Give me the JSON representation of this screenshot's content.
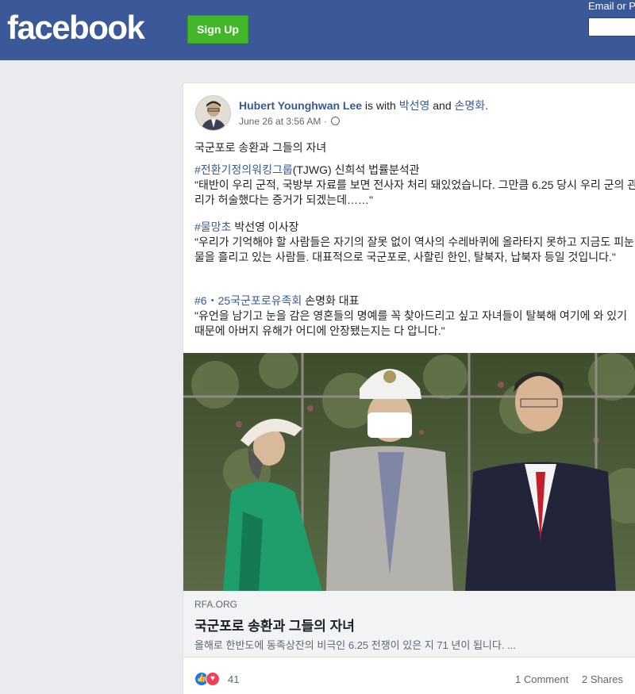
{
  "header": {
    "logo": "facebook",
    "signup_label": "Sign Up",
    "email_label": "Email or P"
  },
  "post": {
    "author": "Hubert Younghwan Lee",
    "with_text": " is with ",
    "tagged1": "박선영",
    "and_text": " and ",
    "tagged2": "손명화",
    "period": ".",
    "date": "June 26 at 3:56 AM · ",
    "title": "국군포로 송환과 그들의 자녀",
    "p1_tag": "#전환기정의워킹그룹",
    "p1_rest": "(TJWG) 신희석 법률분석관",
    "p1_quote": "\"태반이 우리 군적, 국방부 자료를 보면 전사자 처리 돼있었습니다. 그만큼 6.25 당시 우리 군의 관리가 허술했다는 증거가 되겠는데……\"",
    "p2_tag": "#물망초",
    "p2_rest": " 박선영 이사장",
    "p2_quote": "\"우리가 기억해야 할 사람들은 자기의 잘못 없이 역사의 수레바퀴에 올라타지 못하고 지금도 피눈물을 흘리고 있는 사람들. 대표적으로 국군포로, 사할린 한인, 탈북자, 납북자 등일 것입니다.\"",
    "p3_tag": "#6・25국군포로유족회",
    "p3_rest": " 손명화 대표",
    "p3_quote": "\"유언을 남기고 눈을 감은 영혼들의 명예를 꼭 찾아드리고 싶고 자녀들이 탈북해 여기에 와 있기 때문에 아버지 유해가 어디에 안장됐는지는 다 압니다.\""
  },
  "link": {
    "domain": "RFA.ORG",
    "title": "국군포로 송환과 그들의 자녀",
    "description": "올해로 한반도에 동족상잔의 비극인 6.25 전쟁이 있은 지 71 년이 됩니다. ..."
  },
  "footer": {
    "reaction_count": "41",
    "comments": "1 Comment",
    "shares": "2 Shares"
  },
  "colors": {
    "brand": "#3b5998",
    "signup": "#42b72a",
    "link": "#385898"
  }
}
